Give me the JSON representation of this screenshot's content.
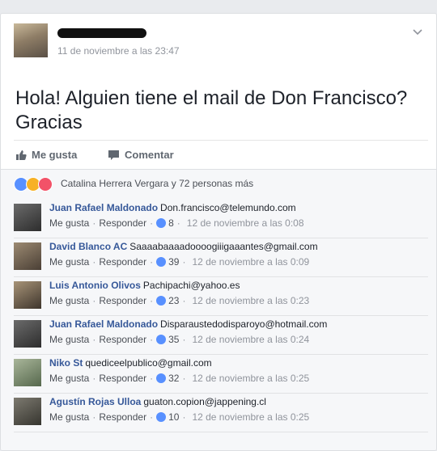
{
  "post": {
    "author_name": "",
    "timestamp": "11 de noviembre a las 23:47",
    "text": "Hola! Alguien tiene el mail de Don Francisco? Gracias"
  },
  "actions": {
    "like_label": "Me gusta",
    "comment_label": "Comentar"
  },
  "reactions": {
    "summary": "Catalina Herrera Vergara y 72 personas más",
    "colors": {
      "like": "#5890ff",
      "haha": "#f7b125",
      "love": "#f25268"
    }
  },
  "comments": [
    {
      "name": "Juan Rafael Maldonado",
      "text": "Don.francisco@telemundo.com",
      "like_label": "Me gusta",
      "reply_label": "Responder",
      "likes": "8",
      "time": "12 de noviembre a las 0:08"
    },
    {
      "name": "David Blanco AC",
      "text": "Saaaabaaaadoooogiiigaaantes@gmail.com",
      "like_label": "Me gusta",
      "reply_label": "Responder",
      "likes": "39",
      "time": "12 de noviembre a las 0:09"
    },
    {
      "name": "Luis Antonio Olivos",
      "text": "Pachipachi@yahoo.es",
      "like_label": "Me gusta",
      "reply_label": "Responder",
      "likes": "23",
      "time": "12 de noviembre a las 0:23"
    },
    {
      "name": "Juan Rafael Maldonado",
      "text": "Disparaustedodisparoyo@hotmail.com",
      "like_label": "Me gusta",
      "reply_label": "Responder",
      "likes": "35",
      "time": "12 de noviembre a las 0:24"
    },
    {
      "name": "Niko St",
      "text": "quediceelpublico@gmail.com",
      "like_label": "Me gusta",
      "reply_label": "Responder",
      "likes": "32",
      "time": "12 de noviembre a las 0:25"
    },
    {
      "name": "Agustín Rojas Ulloa",
      "text": "guaton.copion@jappening.cl",
      "like_label": "Me gusta",
      "reply_label": "Responder",
      "likes": "10",
      "time": "12 de noviembre a las 0:25"
    }
  ]
}
